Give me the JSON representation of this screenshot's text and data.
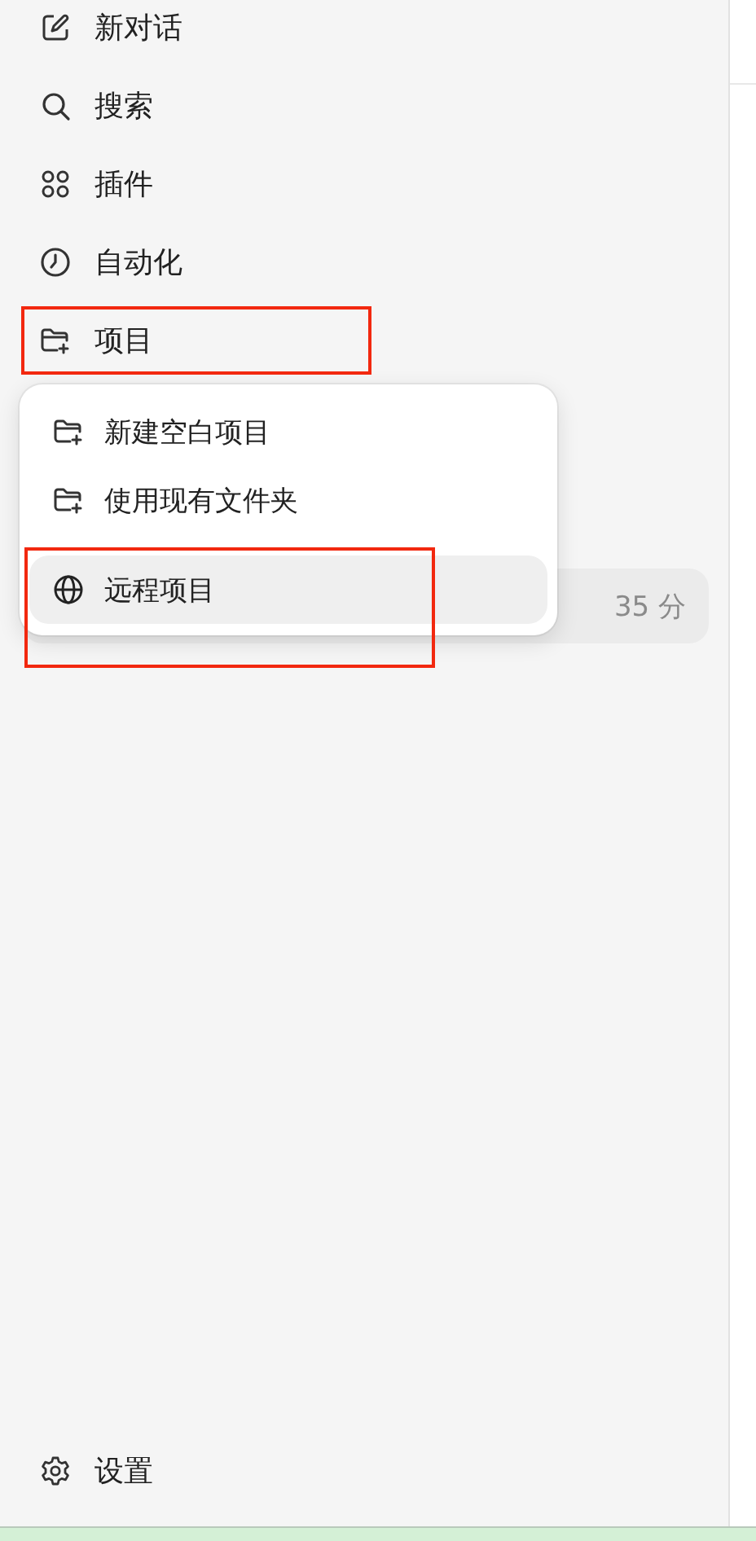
{
  "nav": [
    {
      "label": "新对话"
    },
    {
      "label": "搜索"
    },
    {
      "label": "插件"
    },
    {
      "label": "自动化"
    },
    {
      "label": "项目"
    }
  ],
  "project_menu": {
    "items": [
      {
        "label": "新建空白项目",
        "selected": false
      },
      {
        "label": "使用现有文件夹",
        "selected": false
      },
      {
        "label": "远程项目",
        "selected": true
      }
    ]
  },
  "recent": {
    "time": "35 分"
  },
  "settings": {
    "label": "设置"
  }
}
